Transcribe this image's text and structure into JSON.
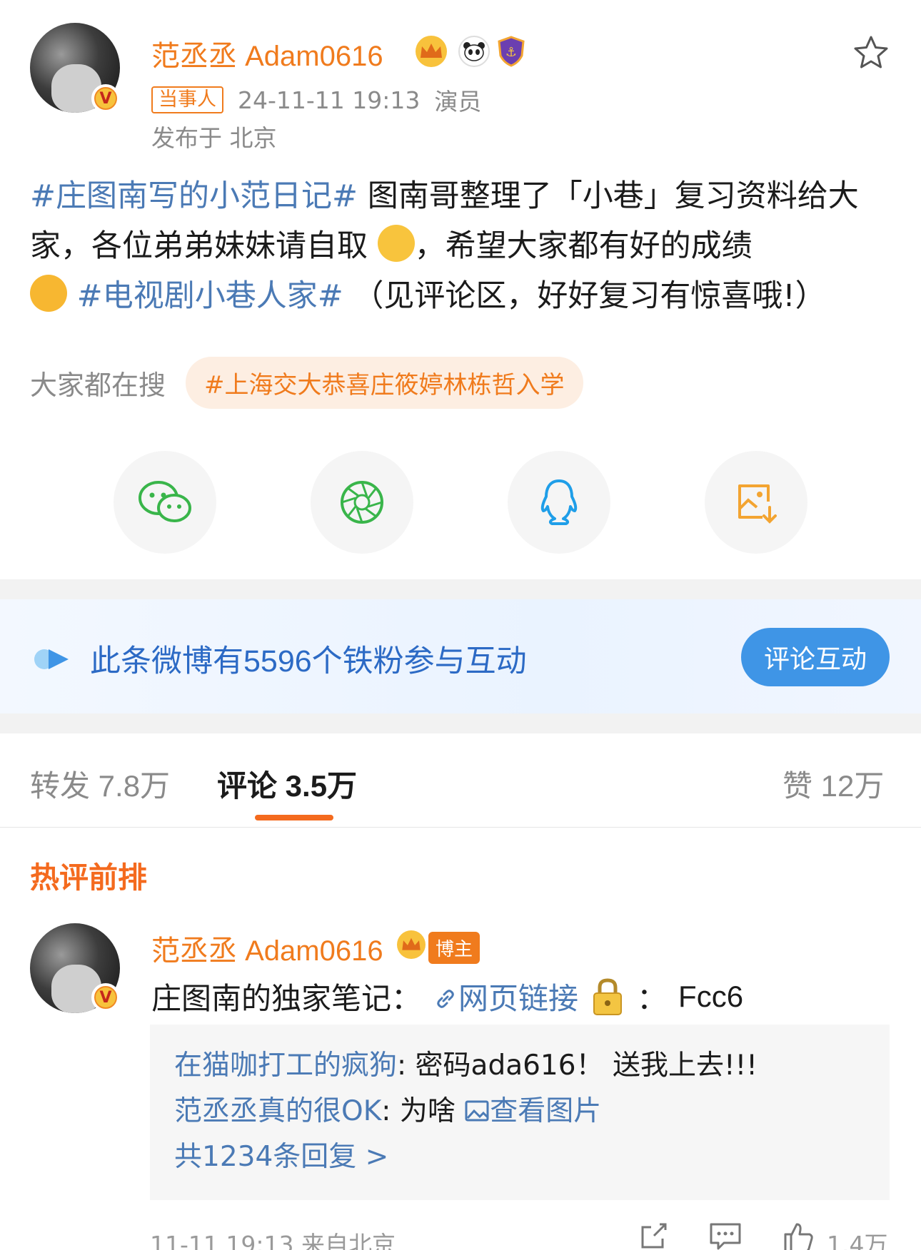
{
  "post": {
    "username": "范丞丞 Adam0616",
    "party_tag": "当事人",
    "datetime": "24-11-11 19:13",
    "role": "演员",
    "location": "发布于 北京",
    "topic1": "#庄图南写的小范日记#",
    "text1": " 图南哥整理了「小巷」复习资料给大家，各位弟弟妹妹请自取",
    "text2": "，希望大家都有好的成绩",
    "topic2": "#电视剧小巷人家#",
    "text3": " （见评论区，好好复习有惊喜哦!）"
  },
  "search": {
    "label": "大家都在搜",
    "pill": "#上海交大恭喜庄筱婷林栋哲入学"
  },
  "share_icons": [
    "wechat-icon",
    "moments-icon",
    "qq-icon",
    "save-image-icon"
  ],
  "fans_banner": {
    "text": "此条微博有5596个铁粉参与互动",
    "button": "评论互动"
  },
  "tabs": {
    "repost": "转发 7.8万",
    "comment": "评论 3.5万",
    "like": "赞 12万"
  },
  "hot_title": "热评前排",
  "comment": {
    "username": "范丞丞 Adam0616",
    "blogger_tag": "博主",
    "text_prefix": "庄图南的独家笔记：",
    "link_label": "网页链接",
    "password_sep": "：",
    "password": "Fcc6",
    "replies": [
      {
        "name": "在猫咖打工的疯狗",
        "text": ": 密码ada616！ 送我上去!!!"
      },
      {
        "name": "范丞丞真的很OK",
        "text": ": 为啥 ",
        "link": "查看图片"
      }
    ],
    "more_replies": "共1234条回复 >",
    "footer": "11-11 19:13 来自北京",
    "likes": "1.4万"
  },
  "colors": {
    "brand_orange": "#f07b1d",
    "link_blue": "#4b7ab5",
    "fans_blue": "#2c6ac5",
    "button_blue": "#3f95e6"
  }
}
